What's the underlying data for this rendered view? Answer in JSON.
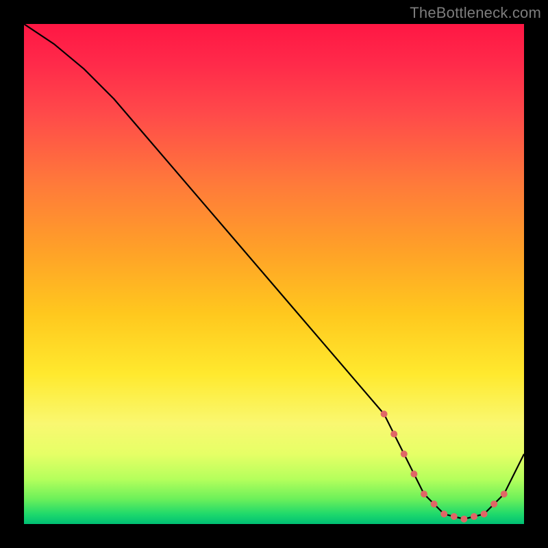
{
  "watermark": "TheBottleneck.com",
  "chart_data": {
    "type": "line",
    "title": "",
    "xlabel": "",
    "ylabel": "",
    "xlim": [
      0,
      100
    ],
    "ylim": [
      0,
      100
    ],
    "x": [
      0,
      6,
      12,
      18,
      24,
      30,
      36,
      42,
      48,
      54,
      60,
      66,
      72,
      76,
      80,
      84,
      88,
      92,
      96,
      100
    ],
    "values": [
      100,
      96,
      91,
      85,
      78,
      71,
      64,
      57,
      50,
      43,
      36,
      29,
      22,
      14,
      6,
      2,
      1,
      2,
      6,
      14
    ],
    "valley_markers_x": [
      72,
      74,
      76,
      78,
      80,
      82,
      84,
      86,
      88,
      90,
      92,
      94,
      96
    ],
    "marker_color": "#e06666",
    "marker_radius_px": 5
  }
}
